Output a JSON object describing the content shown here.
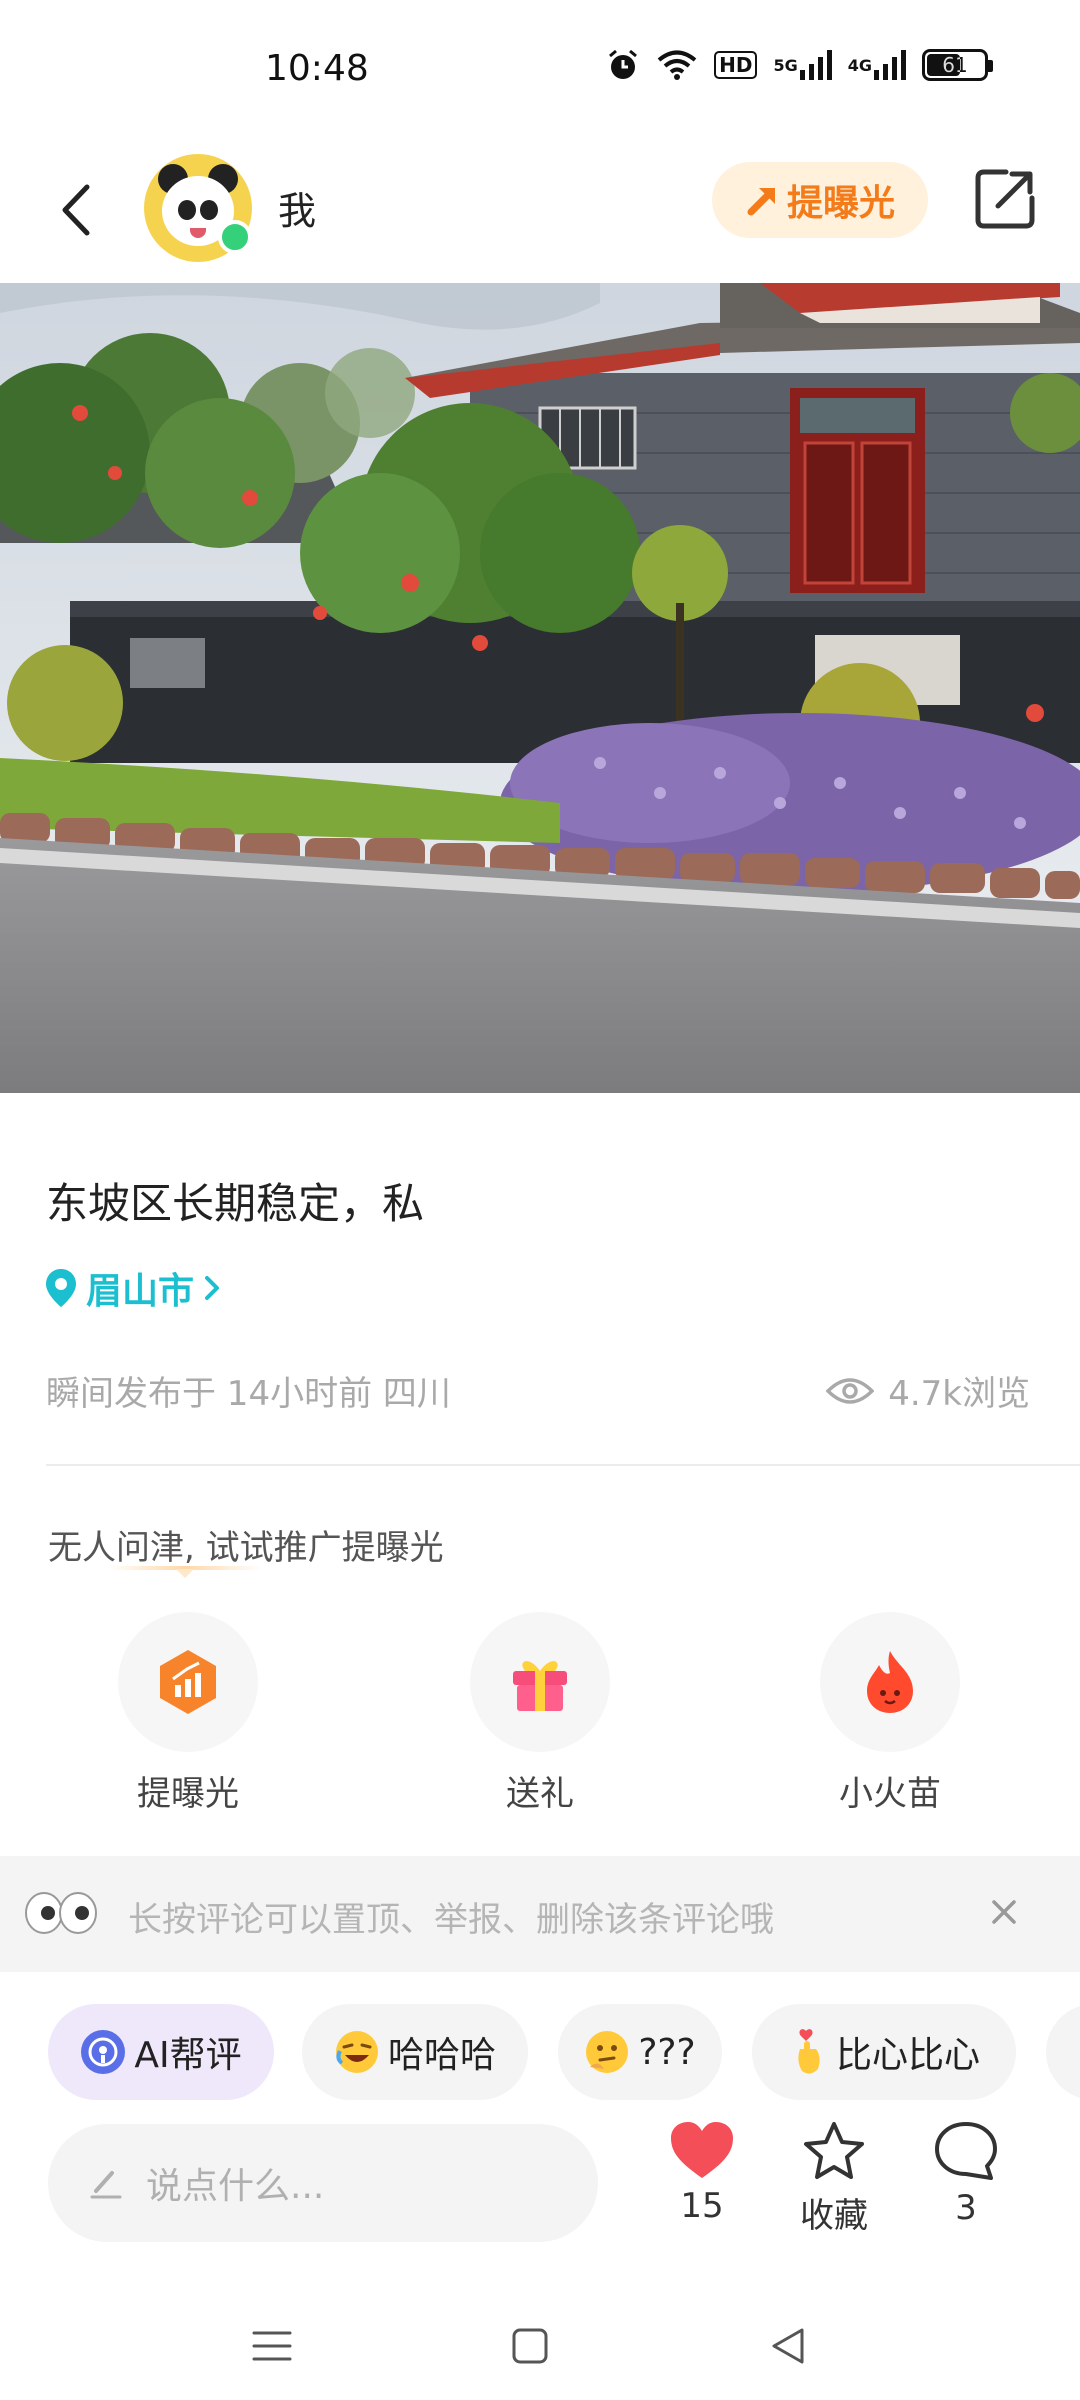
{
  "status_bar": {
    "time": "10:48",
    "network_label_1": "5G",
    "network_label_2": "4G",
    "hd_label": "HD",
    "battery_level": "61",
    "battery_fraction": 0.61
  },
  "header": {
    "username": "我",
    "boost_label": "提曝光",
    "online": true
  },
  "post": {
    "title": "东坡区长期稳定，私",
    "location": "眉山市",
    "meta": "瞬间发布于 14小时前 四川",
    "views": "4.7k浏览"
  },
  "promo": {
    "text": "无人问津, 试试推广提曝光",
    "actions": [
      {
        "label": "提曝光",
        "icon": "boost-chart-icon"
      },
      {
        "label": "送礼",
        "icon": "gift-icon"
      },
      {
        "label": "小火苗",
        "icon": "flame-icon"
      }
    ]
  },
  "tip": {
    "text": "长按评论可以置顶、举报、删除该条评论哦"
  },
  "chips": [
    {
      "label": "AI帮评",
      "icon": "ai-icon"
    },
    {
      "label": "哈哈哈",
      "icon": "laughing-emoji-icon"
    },
    {
      "label": "???",
      "icon": "thinking-emoji-icon"
    },
    {
      "label": "比心比心",
      "icon": "finger-heart-emoji-icon"
    }
  ],
  "bottom_bar": {
    "input_placeholder": "说点什么...",
    "like_count": "15",
    "favorite_label": "收藏",
    "comment_count": "3"
  },
  "colors": {
    "accent_orange": "#f37b1a",
    "location_teal": "#1bbfcf",
    "like_red": "#f44e58",
    "online_green": "#35d07a"
  }
}
